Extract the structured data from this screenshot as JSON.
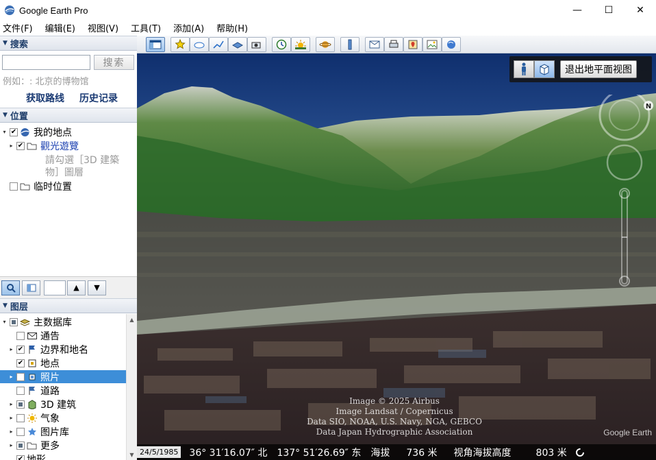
{
  "window": {
    "title": "Google Earth Pro",
    "minimize": "—",
    "maximize": "☐",
    "close": "✕"
  },
  "menu": [
    "文件(F)",
    "编辑(E)",
    "视图(V)",
    "工具(T)",
    "添加(A)",
    "帮助(H)"
  ],
  "search": {
    "header": "搜索",
    "button": "搜索",
    "input_value": "",
    "hint": "例如：: 北京的博物馆",
    "get_directions": "获取路线",
    "history": "历史记录"
  },
  "places": {
    "header": "位置",
    "my_places": "我的地点",
    "tour": "觀光遊覽",
    "tour_note_1": "請勾選［3D 建築",
    "tour_note_2": "物］圖層",
    "temporary": "临时位置"
  },
  "layers": {
    "header": "图层",
    "items": [
      {
        "label": "主数据库",
        "icon": "database-icon",
        "state": "partial",
        "indent": 0,
        "expand": "▾"
      },
      {
        "label": "通告",
        "icon": "envelope-icon",
        "state": "unchecked",
        "indent": 1,
        "expand": ""
      },
      {
        "label": "边界和地名",
        "icon": "flag-icon",
        "state": "checked",
        "indent": 1,
        "expand": "▸"
      },
      {
        "label": "地点",
        "icon": "placemark-icon",
        "state": "checked",
        "indent": 1,
        "expand": ""
      },
      {
        "label": "照片",
        "icon": "photo-icon",
        "state": "unchecked",
        "indent": 1,
        "expand": "▸"
      },
      {
        "label": "道路",
        "icon": "road-icon",
        "state": "unchecked",
        "indent": 1,
        "expand": ""
      },
      {
        "label": "3D 建筑",
        "icon": "building-icon",
        "state": "partial",
        "indent": 1,
        "expand": "▸"
      },
      {
        "label": "气象",
        "icon": "weather-icon",
        "state": "unchecked",
        "indent": 1,
        "expand": "▸"
      },
      {
        "label": "图片库",
        "icon": "star-icon",
        "state": "unchecked",
        "indent": 1,
        "expand": "▸"
      },
      {
        "label": "更多",
        "icon": "more-icon",
        "state": "partial",
        "indent": 1,
        "expand": "▸"
      },
      {
        "label": "地形",
        "icon": "none",
        "state": "checked",
        "indent": 0,
        "expand": ""
      }
    ]
  },
  "view": {
    "exit_ground": "退出地平面视图",
    "compass_n": "N",
    "attribution": [
      "Image © 2025 Airbus",
      "Image Landsat / Copernicus",
      "Data SIO, NOAA, U.S. Navy, NGA, GEBCO",
      "Data Japan Hydrographic Association"
    ],
    "logo": "Google Earth"
  },
  "status": {
    "date": "24/5/1985",
    "lat": "36° 31′16.07″ 北",
    "lon": "137° 51′26.69″ 东",
    "elev_label": "海拔",
    "elev_value": "736 米",
    "eye_label": "视角海拔高度",
    "eye_value": "803 米"
  },
  "colors": {
    "accent": "#3d8ed8",
    "header_text": "#203f6b",
    "link": "#1a3a73"
  }
}
